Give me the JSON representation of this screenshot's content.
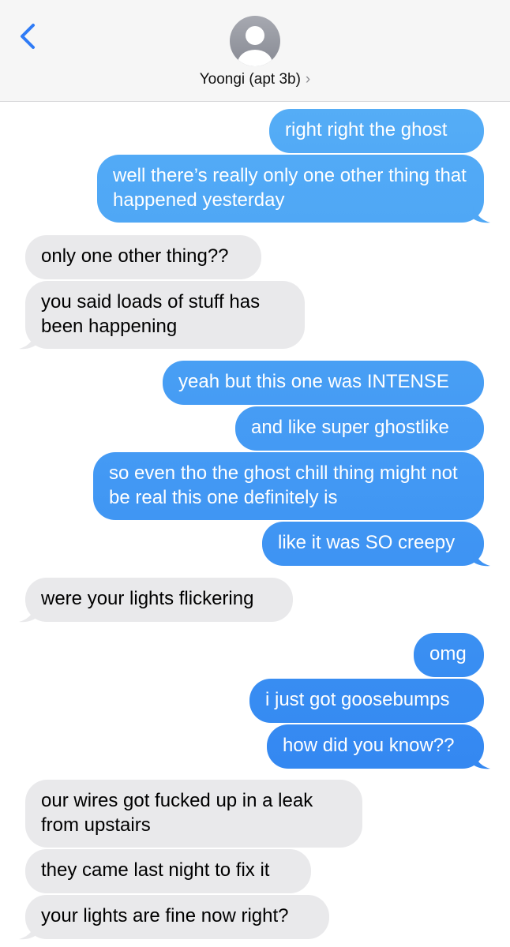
{
  "header": {
    "contact_name": "Yoongi (apt 3b)",
    "chevron": "›",
    "icons": [
      "back-chevron-icon",
      "person-avatar-icon"
    ]
  },
  "colors": {
    "outgoing_top": "#5ab3f7",
    "outgoing_bottom": "#2b7ef0",
    "incoming": "#e9e9eb",
    "accent": "#2f7bf6"
  },
  "messages": [
    {
      "dir": "out",
      "text": "right right the ghost"
    },
    {
      "dir": "out",
      "text": "well there’s really only one other thing that happened yesterday"
    },
    {
      "dir": "in",
      "text": "only one other thing??"
    },
    {
      "dir": "in",
      "text": "you said loads of stuff has been happening"
    },
    {
      "dir": "out",
      "text": "yeah but this one was INTENSE"
    },
    {
      "dir": "out",
      "text": "and like super ghostlike"
    },
    {
      "dir": "out",
      "text": "so even tho the ghost chill thing might not be real this one definitely is"
    },
    {
      "dir": "out",
      "text": "like it was SO creepy"
    },
    {
      "dir": "in",
      "text": "were your lights flickering"
    },
    {
      "dir": "out",
      "text": "omg"
    },
    {
      "dir": "out",
      "text": "i just got goosebumps"
    },
    {
      "dir": "out",
      "text": "how did you know??"
    },
    {
      "dir": "in",
      "text": "our wires got fucked up in a leak from upstairs"
    },
    {
      "dir": "in",
      "text": "they came last night to fix it"
    },
    {
      "dir": "in",
      "text": "your lights are fine now right?"
    }
  ]
}
